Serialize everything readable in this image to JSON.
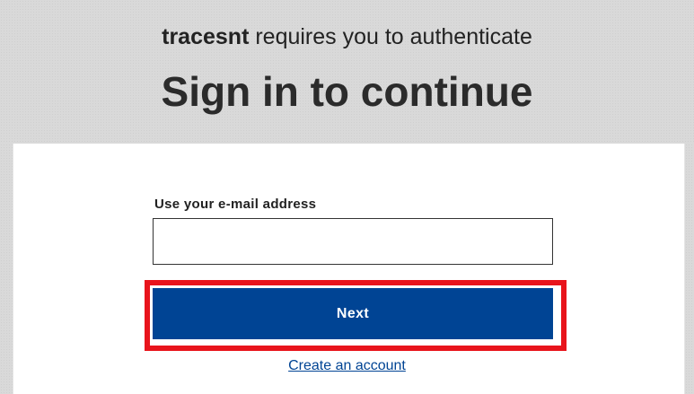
{
  "header": {
    "app_name": "tracesnt",
    "subtitle_rest": " requires you to authenticate",
    "title": "Sign in to continue"
  },
  "form": {
    "email_label": "Use your e-mail address",
    "email_value": "",
    "email_placeholder": "",
    "next_label": "Next",
    "create_account_label": "Create an account"
  },
  "colors": {
    "primary": "#004494",
    "highlight": "#e8141c",
    "header_background": "#d9d9d9"
  }
}
